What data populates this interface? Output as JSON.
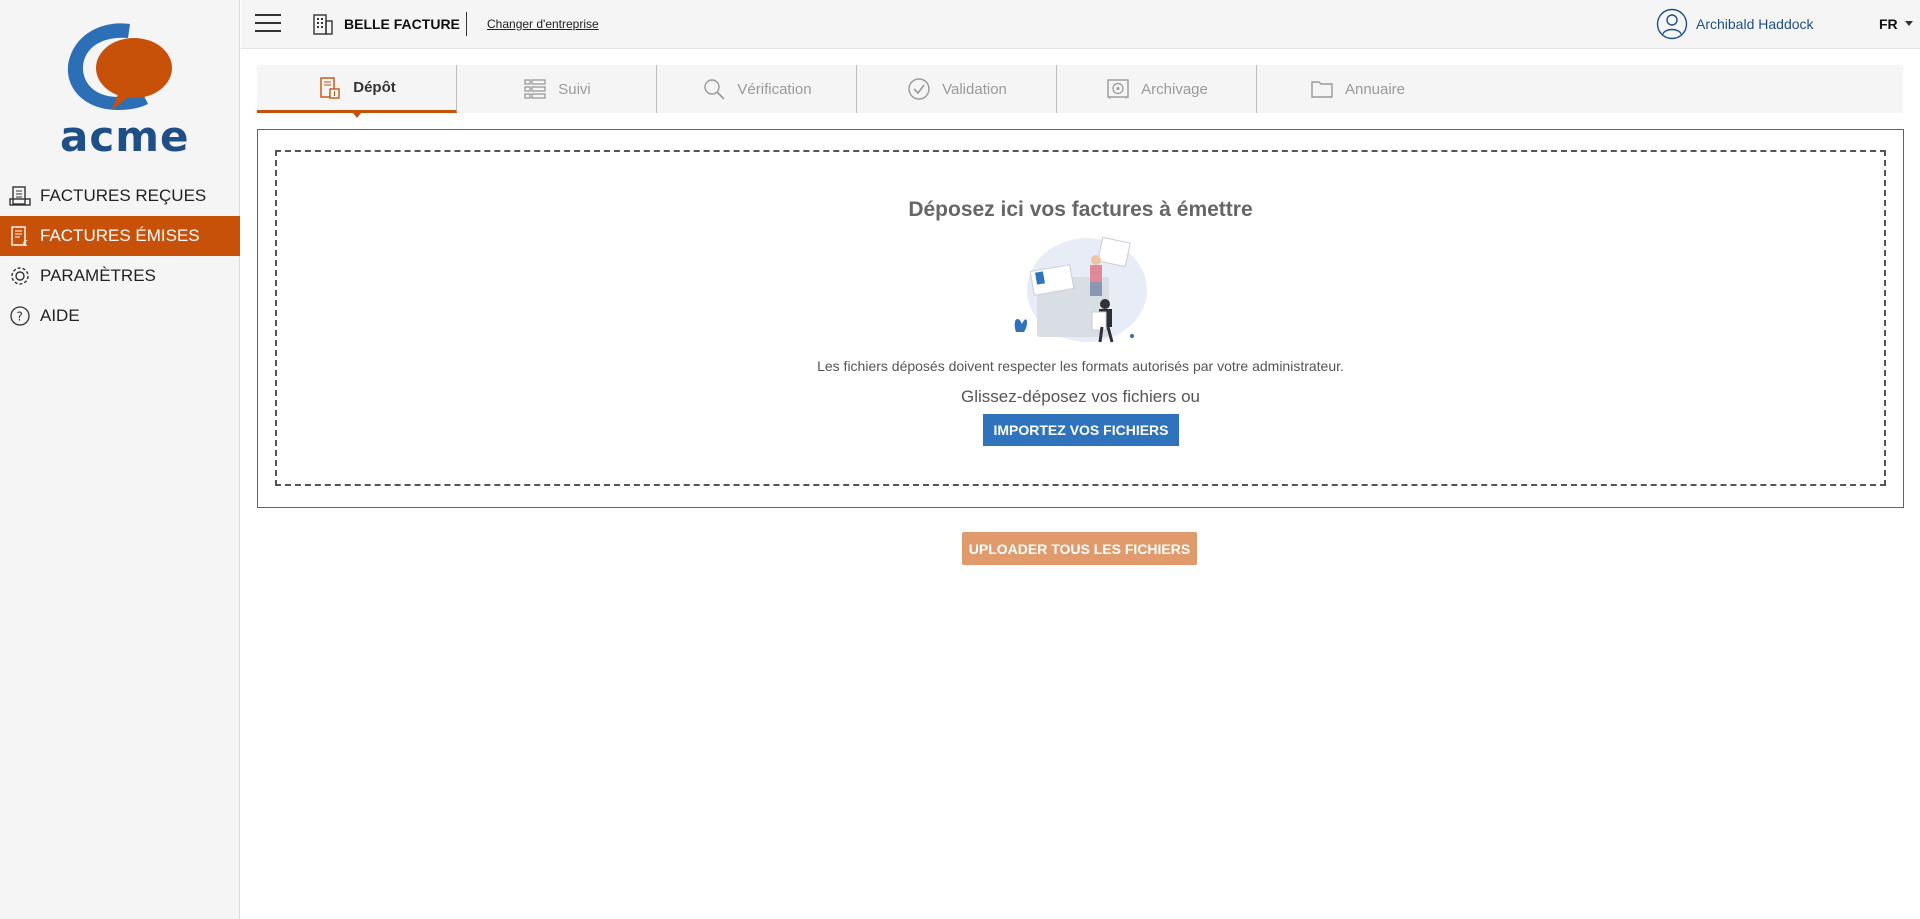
{
  "brand": {
    "name": "acme",
    "accent": "#c8510a",
    "primary": "#1f4f86"
  },
  "sidebar": {
    "items": [
      {
        "label": "FACTURES REÇUES",
        "icon": "received-invoices-icon",
        "active": false
      },
      {
        "label": "FACTURES ÉMISES",
        "icon": "issued-invoices-icon",
        "active": true
      },
      {
        "label": "PARAMÈTRES",
        "icon": "gear-icon",
        "active": false
      },
      {
        "label": "AIDE",
        "icon": "help-icon",
        "active": false
      }
    ]
  },
  "header": {
    "company_name": "BELLE FACTURE",
    "change_company": "Changer d'entreprise",
    "user_name": "Archibald Haddock",
    "language": "FR"
  },
  "tabs": [
    {
      "label": "Dépôt",
      "icon": "deposit-icon",
      "active": true
    },
    {
      "label": "Suivi",
      "icon": "list-icon",
      "active": false
    },
    {
      "label": "Vérification",
      "icon": "search-icon",
      "active": false
    },
    {
      "label": "Validation",
      "icon": "check-circle-icon",
      "active": false
    },
    {
      "label": "Archivage",
      "icon": "archive-icon",
      "active": false
    },
    {
      "label": "Annuaire",
      "icon": "folder-icon",
      "active": false
    }
  ],
  "dropzone": {
    "title": "Déposez ici vos factures à émettre",
    "note": "Les fichiers déposés doivent respecter les formats autorisés par votre administrateur.",
    "hint": "Glissez-déposez vos fichiers ou",
    "import_label": "IMPORTEZ VOS FICHIERS"
  },
  "upload_all_label": "UPLOADER TOUS LES FICHIERS"
}
